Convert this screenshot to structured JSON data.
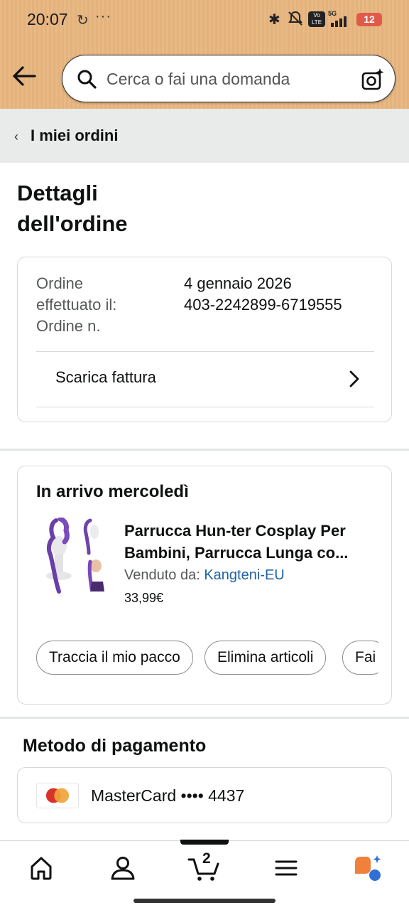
{
  "status_bar": {
    "time": "20:07",
    "dots": "···",
    "battery": "12",
    "network": "5G",
    "volte": "Vo LTE"
  },
  "header": {
    "search_placeholder": "Cerca o fai una domanda",
    "back_icon": "arrow-left-icon",
    "search_icon": "search-icon",
    "camera_icon": "camera-sparkle-icon",
    "bg_color": "#e8b984"
  },
  "breadcrumb": {
    "label": "I miei ordini"
  },
  "page": {
    "title_line1": "Dettagli",
    "title_line2": "dell'ordine"
  },
  "order_info": {
    "label_line1": "Ordine",
    "label_line2": "effettuato il:",
    "label_line3": "Ordine n.",
    "date": "4 gennaio 2026",
    "number": "403-2242899-6719555",
    "invoice_label": "Scarica fattura"
  },
  "shipment": {
    "heading": "In arrivo mercoledì",
    "product_title_line1": "Parrucca Hun-ter Cosplay Per",
    "product_title_line2": "Bambini, Parrucca Lunga co...",
    "seller_prefix": "Venduto da:",
    "seller_name": "Kangteni-EU",
    "price": "33,99€",
    "actions": [
      "Traccia il mio pacco",
      "Elimina articoli",
      "Fai"
    ]
  },
  "payment": {
    "title": "Metodo di pagamento",
    "card_text": "MasterCard •••• 4437",
    "card_icon": "mastercard-icon"
  },
  "bottom_nav": {
    "items": [
      "home-icon",
      "account-icon",
      "cart-icon",
      "menu-icon",
      "rufus-icon"
    ],
    "cart_count": "2"
  },
  "colors": {
    "link": "#2162a1",
    "text": "#0f1111",
    "muted": "#565959"
  }
}
